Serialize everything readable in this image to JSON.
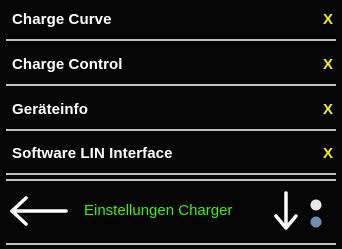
{
  "menu": {
    "items": [
      {
        "label": "Charge Curve",
        "mark": "X"
      },
      {
        "label": "Charge Control",
        "mark": "X"
      },
      {
        "label": "Geräteinfo",
        "mark": "X"
      },
      {
        "label": "Software LIN Interface",
        "mark": "X"
      }
    ]
  },
  "footer": {
    "title": "Einstellungen Charger",
    "back_icon": "arrow-left-icon",
    "down_icon": "arrow-down-icon",
    "more_icon": "more-dots-icon"
  },
  "colors": {
    "background": "#000000",
    "row_text": "#ffffff",
    "mark": "#f2ee1a",
    "footer_title": "#3ff00a",
    "divider": "#bfbfbf"
  }
}
